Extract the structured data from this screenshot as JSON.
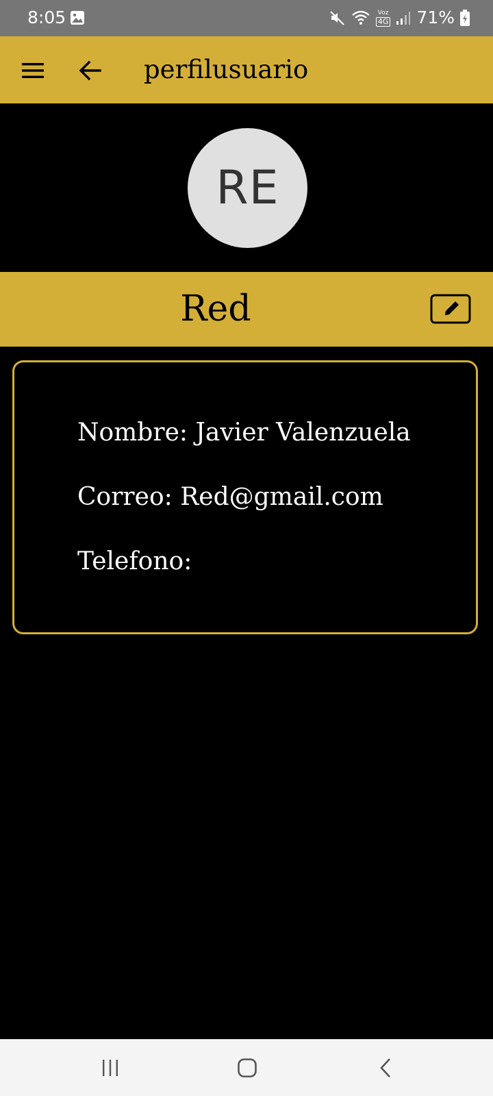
{
  "status_bar": {
    "time": "8:05",
    "volte_label": "Voz",
    "network_label": "4G",
    "battery_percent": "71%",
    "icons": [
      "gallery-icon",
      "mute-icon",
      "wifi-icon",
      "volte-4g-icon",
      "signal-icon",
      "battery-icon"
    ]
  },
  "app_bar": {
    "title": "perfilusuario",
    "menu_icon": "hamburger-menu-icon",
    "back_icon": "arrow-left-icon"
  },
  "profile": {
    "avatar_initials": "RE",
    "username": "Red",
    "edit_icon": "edit-pencil-icon"
  },
  "info": {
    "nombre_label": "Nombre:",
    "nombre_value": "Javier Valenzuela",
    "correo_label": "Correo:",
    "correo_value": "Red@gmail.com",
    "telefono_label": "Telefono:",
    "telefono_value": ""
  },
  "nav_bar": {
    "icons": [
      "recents-icon",
      "home-icon",
      "back-icon"
    ]
  },
  "colors": {
    "accent": "#d4af37",
    "background": "#000000",
    "status_bar": "#767676",
    "avatar_bg": "#e0e0e0",
    "nav_bar": "#f4f4f4"
  }
}
